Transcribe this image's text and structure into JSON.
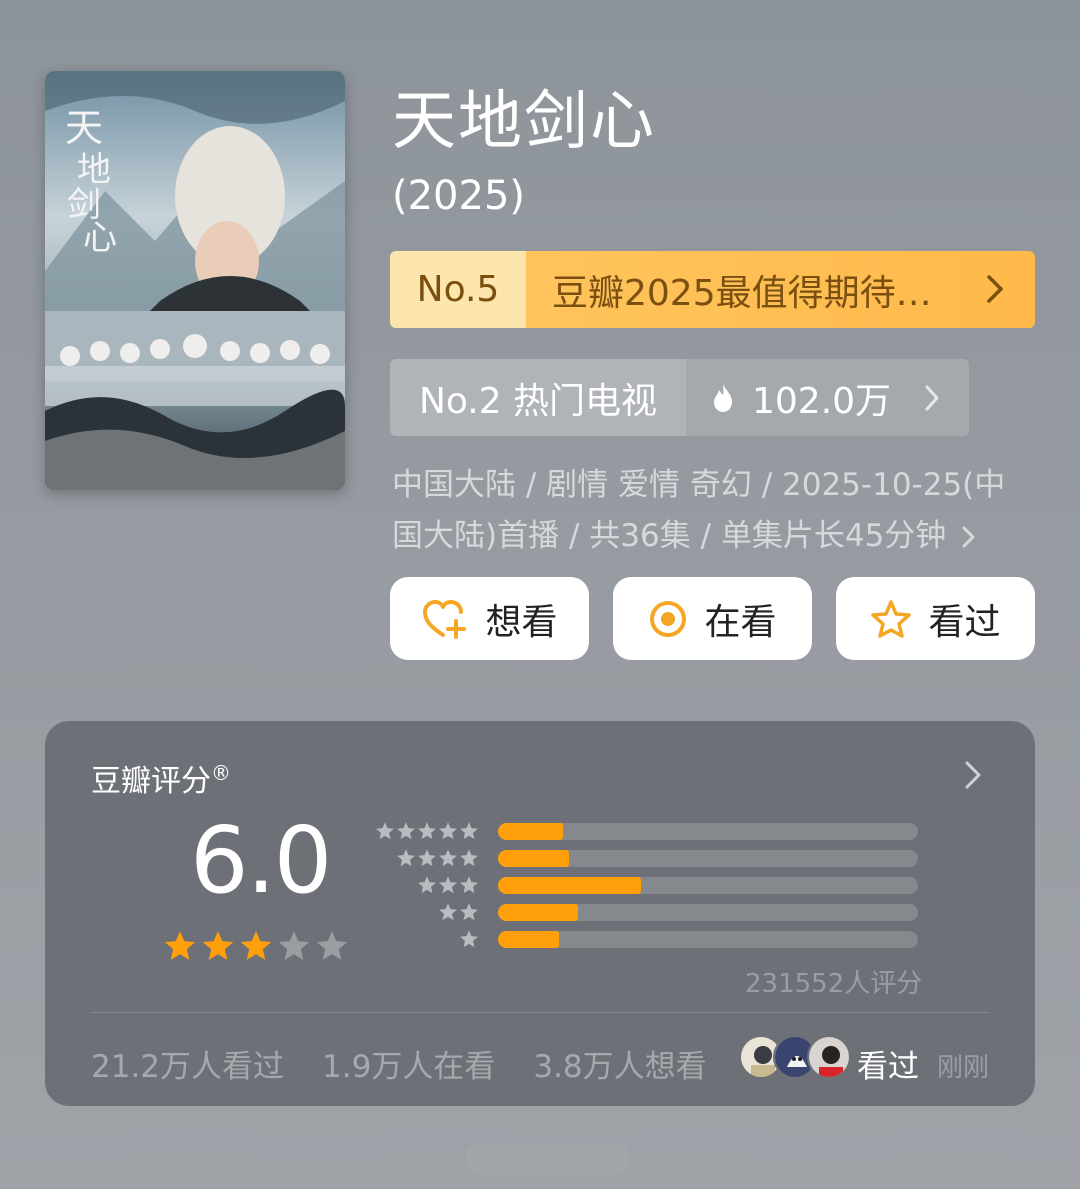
{
  "show": {
    "title": "天地剑心",
    "year": "(2025)",
    "poster_title_art": "天地剑心"
  },
  "rank_banner": {
    "rank": "No.5",
    "list_name": "豆瓣2025最值得期待…"
  },
  "hot_banner": {
    "rank": "No.2 热门电视",
    "count": "102.0万"
  },
  "meta": {
    "line1": "中国大陆 / 剧情 爱情 奇幻 / 2025-10-25(中",
    "line2": "国大陆)首播 / 共36集 / 单集片长45分钟"
  },
  "actions": [
    {
      "label": "想看",
      "icon": "heart-plus-icon"
    },
    {
      "label": "在看",
      "icon": "watching-dot-icon"
    },
    {
      "label": "看过",
      "icon": "star-outline-icon"
    }
  ],
  "rating": {
    "label": "豆瓣评分",
    "registered_mark": "®",
    "score": "6.0",
    "score_stars": 3,
    "distribution": [
      {
        "stars": 5,
        "fraction": 0.155
      },
      {
        "stars": 4,
        "fraction": 0.17
      },
      {
        "stars": 3,
        "fraction": 0.34
      },
      {
        "stars": 2,
        "fraction": 0.19
      },
      {
        "stars": 1,
        "fraction": 0.145
      }
    ],
    "count_text": "231552人评分"
  },
  "stats": {
    "watched": "21.2万人看过",
    "watching": "1.9万人在看",
    "want": "3.8万人想看",
    "friend_action": "看过",
    "friend_time": "刚刚"
  },
  "colors": {
    "accent_orange": "#ff9f0a",
    "rank_bg": "#ffb94a",
    "card_bg": "#6d7177"
  }
}
